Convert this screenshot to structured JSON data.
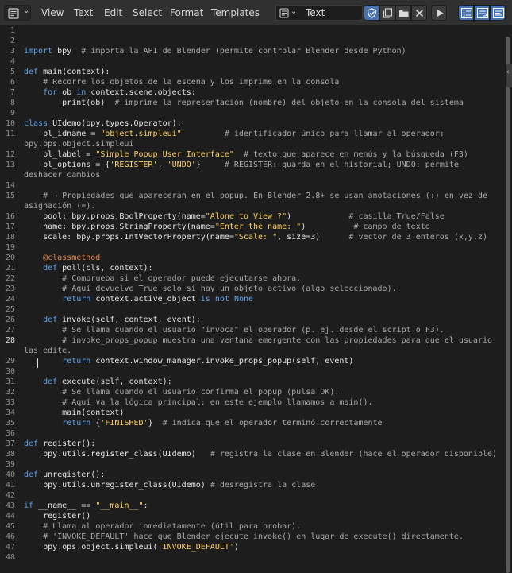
{
  "header": {
    "menu": [
      "View",
      "Text",
      "Edit",
      "Select",
      "Format",
      "Templates"
    ],
    "file_name": "Text",
    "icons": [
      "text-editor-icon",
      "fake-user-shield-icon",
      "new-text-icon",
      "open-folder-icon",
      "unlink-text-icon",
      "run-script-icon",
      "line-numbers-icon",
      "word-wrap-icon",
      "syntax-highlight-icon"
    ]
  },
  "editor": {
    "current_line": 28,
    "lines": [
      {
        "n": "1",
        "t": ""
      },
      {
        "n": "2",
        "t": ""
      },
      {
        "n": "3",
        "t": "import bpy  # importa la API de Blender (permite controlar Blender desde Python)"
      },
      {
        "n": "4",
        "t": ""
      },
      {
        "n": "5",
        "t": "def main(context):"
      },
      {
        "n": "6",
        "t": "    # Recorre los objetos de la escena y los imprime en la consola"
      },
      {
        "n": "7",
        "t": "    for ob in context.scene.objects:"
      },
      {
        "n": "8",
        "t": "        print(ob)  # imprime la representación (nombre) del objeto en la consola del sistema"
      },
      {
        "n": "9",
        "t": ""
      },
      {
        "n": "10",
        "t": "class UIdemo(bpy.types.Operator):"
      },
      {
        "n": "11",
        "t": "    bl_idname = \"object.simpleui\"         # identificador único para llamar al operador:"
      },
      {
        "n": "",
        "t": "bpy.ops.object.simpleui"
      },
      {
        "n": "12",
        "t": "    bl_label = \"Simple Popup User Interface\"  # texto que aparece en menús y la búsqueda (F3)"
      },
      {
        "n": "13",
        "t": "    bl_options = {'REGISTER', 'UNDO'}     # REGISTER: guarda en el historial; UNDO: permite"
      },
      {
        "n": "",
        "t": "deshacer cambios"
      },
      {
        "n": "14",
        "t": ""
      },
      {
        "n": "15",
        "t": "    # → Propiedades que aparecerán en el popup. En Blender 2.8+ se usan anotaciones (:) en vez de"
      },
      {
        "n": "",
        "t": "asignación (=)."
      },
      {
        "n": "16",
        "t": "    bool: bpy.props.BoolProperty(name=\"Alone to View ?\")            # casilla True/False"
      },
      {
        "n": "17",
        "t": "    name: bpy.props.StringProperty(name=\"Enter the name: \")          # campo de texto"
      },
      {
        "n": "18",
        "t": "    scale: bpy.props.IntVectorProperty(name=\"Scale: \", size=3)      # vector de 3 enteros (x,y,z)"
      },
      {
        "n": "19",
        "t": ""
      },
      {
        "n": "20",
        "t": "    @classmethod"
      },
      {
        "n": "21",
        "t": "    def poll(cls, context):"
      },
      {
        "n": "22",
        "t": "        # Comprueba si el operador puede ejecutarse ahora."
      },
      {
        "n": "23",
        "t": "        # Aquí devuelve True solo si hay un objeto activo (algo seleccionado)."
      },
      {
        "n": "24",
        "t": "        return context.active_object is not None"
      },
      {
        "n": "25",
        "t": ""
      },
      {
        "n": "26",
        "t": "    def invoke(self, context, event):"
      },
      {
        "n": "27",
        "t": "        # Se llama cuando el usuario \"invoca\" el operador (p. ej. desde el script o F3)."
      },
      {
        "n": "28",
        "t": "        # invoke_props_popup muestra una ventana emergente con las propiedades para que el usuario"
      },
      {
        "n": "",
        "t": "las edite."
      },
      {
        "n": "29",
        "t": "        return context.window_manager.invoke_props_popup(self, event)"
      },
      {
        "n": "30",
        "t": ""
      },
      {
        "n": "31",
        "t": "    def execute(self, context):"
      },
      {
        "n": "32",
        "t": "        # Se llama cuando el usuario confirma el popup (pulsa OK)."
      },
      {
        "n": "33",
        "t": "        # Aquí va la lógica principal: en este ejemplo llamamos a main()."
      },
      {
        "n": "34",
        "t": "        main(context)"
      },
      {
        "n": "35",
        "t": "        return {'FINISHED'}  # indica que el operador terminó correctamente"
      },
      {
        "n": "36",
        "t": ""
      },
      {
        "n": "37",
        "t": "def register():"
      },
      {
        "n": "38",
        "t": "    bpy.utils.register_class(UIdemo)   # registra la clase en Blender (hace el operador disponible)"
      },
      {
        "n": "39",
        "t": ""
      },
      {
        "n": "40",
        "t": "def unregister():"
      },
      {
        "n": "41",
        "t": "    bpy.utils.unregister_class(UIdemo) # desregistra la clase"
      },
      {
        "n": "42",
        "t": ""
      },
      {
        "n": "43",
        "t": "if __name__ == \"__main__\":"
      },
      {
        "n": "44",
        "t": "    register()"
      },
      {
        "n": "45",
        "t": "    # Llama al operador inmediatamente (útil para probar)."
      },
      {
        "n": "46",
        "t": "    # 'INVOKE_DEFAULT' hace que Blender ejecute invoke() en lugar de execute() directamente."
      },
      {
        "n": "47",
        "t": "    bpy.ops.object.simpleui('INVOKE_DEFAULT')"
      },
      {
        "n": "48",
        "t": ""
      }
    ]
  }
}
